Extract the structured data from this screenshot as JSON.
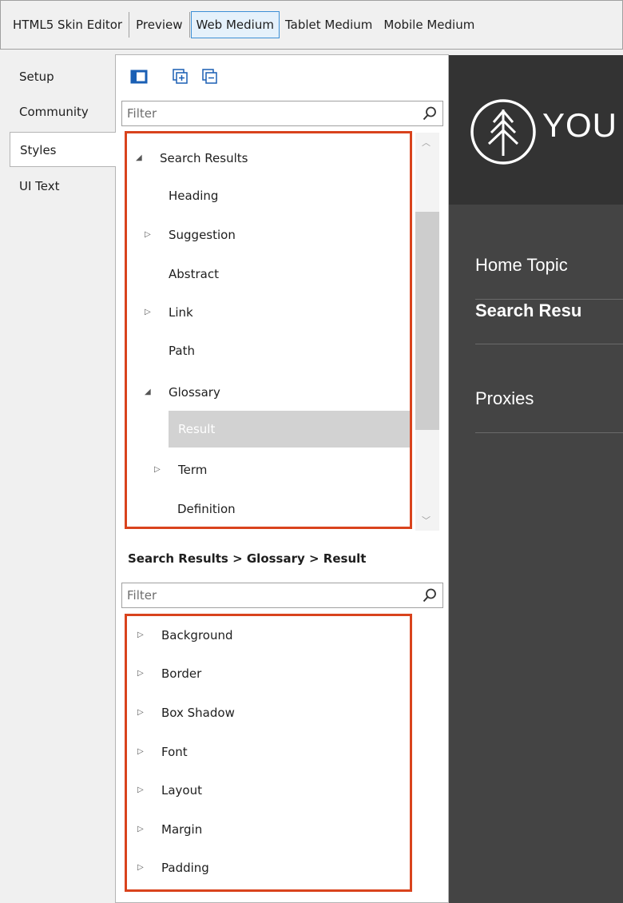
{
  "toolbar": {
    "items": [
      {
        "label": "HTML5 Skin Editor",
        "active": false
      },
      {
        "label": "Preview",
        "active": false
      },
      {
        "label": "Web Medium",
        "active": true
      },
      {
        "label": "Tablet Medium",
        "active": false
      },
      {
        "label": "Mobile Medium",
        "active": false
      }
    ]
  },
  "tabs": [
    {
      "label": "Setup",
      "active": false
    },
    {
      "label": "Community",
      "active": false
    },
    {
      "label": "Styles",
      "active": true
    },
    {
      "label": "UI Text",
      "active": false
    }
  ],
  "icons": {
    "view_toggle": "panel-toggle-icon",
    "expand_all": "expand-all-icon",
    "collapse_all": "collapse-all-icon",
    "search": "search-icon"
  },
  "style_tree": {
    "filter_placeholder": "Filter",
    "items": [
      {
        "label": "Search Results",
        "level": 0,
        "arrow": "expanded"
      },
      {
        "label": "Heading",
        "level": 1,
        "arrow": "none"
      },
      {
        "label": "Suggestion",
        "level": 1,
        "arrow": "collapsed"
      },
      {
        "label": "Abstract",
        "level": 1,
        "arrow": "none"
      },
      {
        "label": "Link",
        "level": 1,
        "arrow": "collapsed"
      },
      {
        "label": "Path",
        "level": 1,
        "arrow": "none"
      },
      {
        "label": "Glossary",
        "level": 1,
        "arrow": "expanded"
      },
      {
        "label": "Result",
        "level": 2,
        "arrow": "none",
        "selected": true
      },
      {
        "label": "Term",
        "level": 2,
        "arrow": "collapsed"
      },
      {
        "label": "Definition",
        "level": 2,
        "arrow": "none"
      }
    ]
  },
  "breadcrumb": "Search Results > Glossary > Result",
  "properties": {
    "filter_placeholder": "Filter",
    "items": [
      "Background",
      "Border",
      "Box Shadow",
      "Font",
      "Layout",
      "Margin",
      "Padding"
    ]
  },
  "preview": {
    "logo_text": "YOU",
    "menu": [
      {
        "label": "Home Topic",
        "bold": false
      },
      {
        "label": "Search Resu",
        "bold": true
      },
      {
        "label": "Proxies",
        "bold": false
      }
    ]
  },
  "colors": {
    "highlight_box": "#d9431d",
    "preview_header": "#333333",
    "preview_body": "#444444",
    "active_toolbar_border": "#3c8fd6",
    "selected_row": "#d2d2d2"
  }
}
